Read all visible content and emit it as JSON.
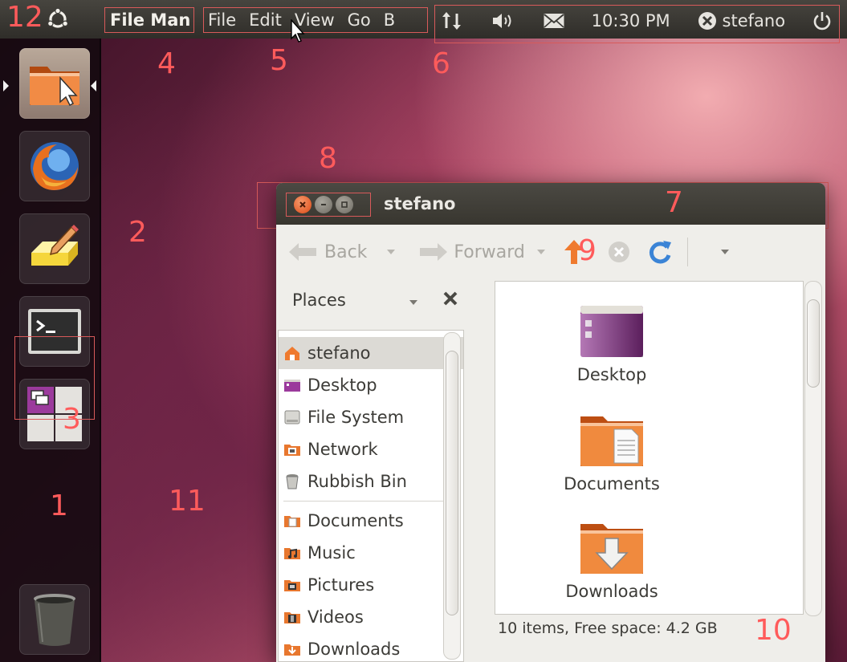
{
  "panel": {
    "app_title": "File Man",
    "menus": [
      "File",
      "Edit",
      "View",
      "Go",
      "B"
    ],
    "clock": "10:30 PM",
    "user": "stefano"
  },
  "window": {
    "title": "stefano",
    "toolbar": {
      "back_label": "Back",
      "forward_label": "Forward"
    },
    "places_label": "Places",
    "sidebar_items": [
      {
        "label": "stefano",
        "icon": "home-folder-icon",
        "selected": true
      },
      {
        "label": "Desktop",
        "icon": "desktop-icon"
      },
      {
        "label": "File System",
        "icon": "drive-icon"
      },
      {
        "label": "Network",
        "icon": "network-icon"
      },
      {
        "label": "Rubbish Bin",
        "icon": "trash-icon"
      },
      {
        "label": "Documents",
        "icon": "documents-folder-icon"
      },
      {
        "label": "Music",
        "icon": "music-folder-icon"
      },
      {
        "label": "Pictures",
        "icon": "pictures-folder-icon"
      },
      {
        "label": "Videos",
        "icon": "videos-folder-icon"
      },
      {
        "label": "Downloads",
        "icon": "downloads-folder-icon"
      }
    ],
    "files": [
      {
        "label": "Desktop",
        "icon": "desktop-folder-icon"
      },
      {
        "label": "Documents",
        "icon": "documents-folder-icon"
      },
      {
        "label": "Downloads",
        "icon": "downloads-folder-icon"
      }
    ],
    "status": "10 items, Free space: 4.2 GB"
  },
  "annotations": [
    "1",
    "2",
    "3",
    "4",
    "5",
    "6",
    "7",
    "8",
    "9",
    "10",
    "11",
    "12"
  ],
  "colors": {
    "annotation": "#ff5b5b",
    "accent_orange": "#dd4814",
    "panel": "#3c3b37",
    "wallpaper": "#7a2c4c"
  }
}
